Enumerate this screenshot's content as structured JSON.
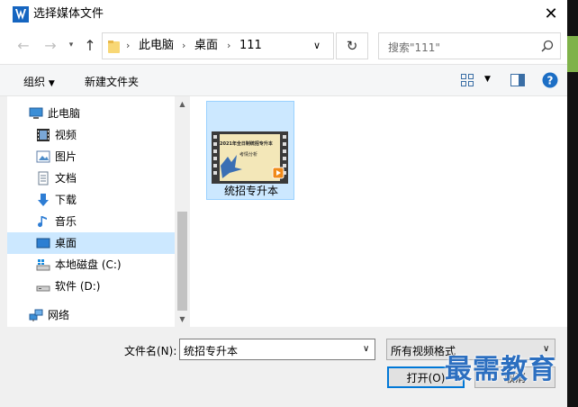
{
  "window": {
    "title": "选择媒体文件"
  },
  "address": {
    "crumbs": [
      "此电脑",
      "桌面",
      "111"
    ]
  },
  "search": {
    "placeholder": "搜索\"111\""
  },
  "toolbar": {
    "organize": "组织",
    "new_folder": "新建文件夹"
  },
  "tree": [
    {
      "label": "此电脑",
      "icon": "computer-icon"
    },
    {
      "label": "视频",
      "icon": "video-folder-icon"
    },
    {
      "label": "图片",
      "icon": "pictures-folder-icon"
    },
    {
      "label": "文档",
      "icon": "documents-folder-icon"
    },
    {
      "label": "下载",
      "icon": "download-arrow-icon"
    },
    {
      "label": "音乐",
      "icon": "music-note-icon"
    },
    {
      "label": "桌面",
      "icon": "desktop-icon",
      "selected": true
    },
    {
      "label": "本地磁盘 (C:)",
      "icon": "system-drive-icon"
    },
    {
      "label": "软件 (D:)",
      "icon": "drive-icon"
    },
    {
      "label": "网络",
      "icon": "network-icon"
    }
  ],
  "files": [
    {
      "name": "统招专升本",
      "thumb_title": "2021年全日制统招专升本",
      "thumb_subtitle": "考情分析"
    }
  ],
  "bottom": {
    "filename_label": "文件名(N):",
    "filename_value": "统招专升本",
    "filter_value": "所有视频格式",
    "open_label": "打开(O)",
    "cancel_label": "取消"
  },
  "watermark": "最需教育",
  "colors": {
    "selection": "#cce8ff",
    "accent": "#0078d7",
    "help": "#1c6ec5"
  }
}
